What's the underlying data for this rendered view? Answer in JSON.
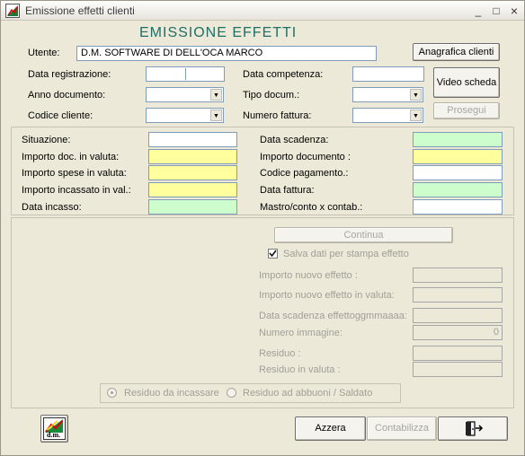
{
  "window": {
    "title": "Emissione effetti clienti",
    "minimize": "_",
    "maximize": "□",
    "close": "×"
  },
  "header": {
    "title": "EMISSIONE EFFETTI"
  },
  "top": {
    "utente_label": "Utente:",
    "utente_value": "D.M. SOFTWARE DI DELL'OCA MARCO",
    "anagrafica_button": "Anagrafica clienti",
    "data_registrazione_label": "Data registrazione:",
    "data_competenza_label": "Data competenza:",
    "video_scheda_button": "Video scheda",
    "anno_documento_label": "Anno documento:",
    "tipo_docum_label": "Tipo docum.:",
    "codice_cliente_label": "Codice cliente:",
    "numero_fattura_label": "Numero fattura:",
    "prosegui_button": "Prosegui"
  },
  "details": {
    "situazione_label": "Situazione:",
    "importo_doc_valuta_label": "Importo doc. in valuta:",
    "importo_spese_valuta_label": "Importo spese in valuta:",
    "importo_incassato_val_label": "Importo incassato in val.:",
    "data_incasso_label": "Data incasso:",
    "data_scadenza_label": "Data scadenza:",
    "importo_documento_label": "Importo documento :",
    "codice_pagamento_label": "Codice pagamento.:",
    "data_fattura_label": "Data fattura:",
    "mastro_conto_label": "Mastro/conto x contab.:"
  },
  "lower": {
    "continua_button": "Continua",
    "salva_dati_label": "Salva dati per stampa effetto",
    "salva_dati_checked": true,
    "importo_nuovo_label": "Importo nuovo effetto :",
    "importo_nuovo_valuta_label": "Importo nuovo effetto in valuta:",
    "data_scadenza_effetto_label": "Data scadenza effettoggmmaaaa:",
    "numero_immagine_label": "Numero immagine:",
    "numero_immagine_value": "0",
    "residuo_label": "Residuo :",
    "residuo_valuta_label": "Residuo in valuta :",
    "radio_residuo_incassare": "Residuo da incassare",
    "radio_residuo_abbuoni": "Residuo ad abbuoni / Saldato"
  },
  "footer": {
    "logo_text": "d.m.",
    "azzera_button": "Azzera",
    "contabilizza_button": "Contabilizza",
    "exit_icon": "exit-door-icon"
  },
  "colors": {
    "yellow_field": "#ffff9e",
    "green_field": "#cdfccd",
    "header_teal": "#1e6f66"
  }
}
